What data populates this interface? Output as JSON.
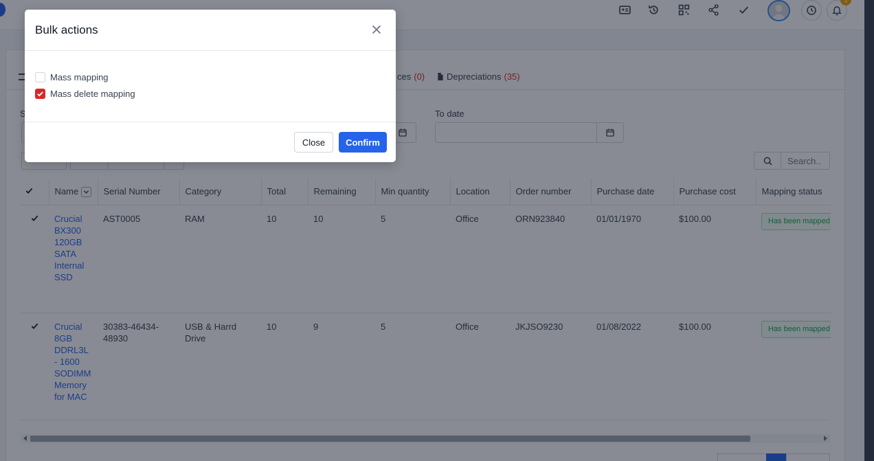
{
  "modal": {
    "title": "Bulk actions",
    "options": [
      {
        "label": "Mass mapping",
        "checked": false
      },
      {
        "label": "Mass delete mapping",
        "checked": true
      }
    ],
    "close_label": "Close",
    "confirm_label": "Confirm"
  },
  "tabs": [
    {
      "label": "ces",
      "count": "(0)"
    },
    {
      "label": "Depreciations",
      "count": "(35)"
    }
  ],
  "filters": {
    "to_date_label": "To date",
    "partial_label": "S"
  },
  "toolbar": {
    "search_placeholder": "Search.."
  },
  "table": {
    "columns": [
      "Name",
      "Serial Number",
      "Category",
      "Total",
      "Remaining",
      "Min quantity",
      "Location",
      "Order number",
      "Purchase date",
      "Purchase cost",
      "Mapping status"
    ],
    "rows": [
      {
        "name": "Crucial BX300 120GB SATA Internal SSD",
        "serial": "AST0005",
        "category": "RAM",
        "total": "10",
        "remaining": "10",
        "min_quantity": "5",
        "location": "Office",
        "order_number": "ORN923840",
        "purchase_date": "01/01/1970",
        "purchase_cost": "$100.00",
        "status": "Has been mapped"
      },
      {
        "name": "Crucial 8GB DDRL3L - 1600 SODIMM Memory for MAC",
        "serial": "30383-46434-48930",
        "category": "USB & Harrd Drive",
        "total": "10",
        "remaining": "9",
        "min_quantity": "5",
        "location": "Office",
        "order_number": "JKJSO9230",
        "purchase_date": "01/08/2022",
        "purchase_cost": "$100.00",
        "status": "Has been mapped"
      }
    ]
  },
  "header": {
    "notification_count": "1"
  },
  "colors": {
    "accent": "#2563eb",
    "checked": "#dc2626",
    "status_green": "#16a34a"
  }
}
